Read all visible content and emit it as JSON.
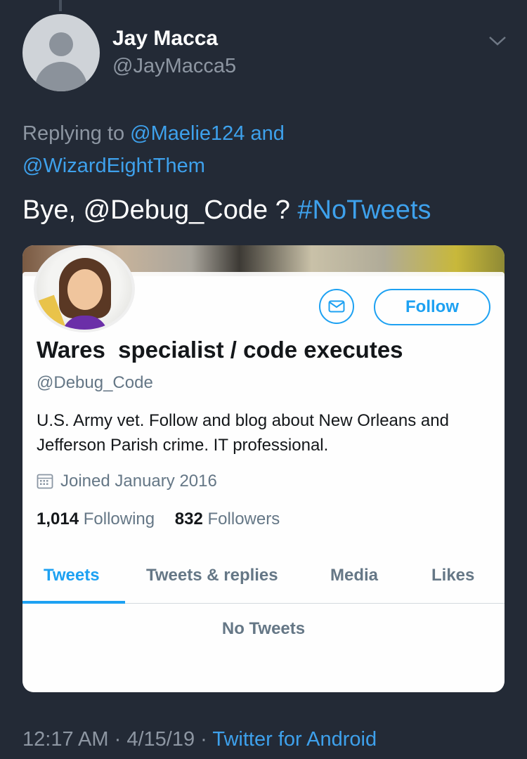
{
  "tweet": {
    "author_name": "Jay Macca",
    "author_handle": "@JayMacca5",
    "replying_prefix": "Replying to",
    "reply_to_1": "@Maelie124",
    "reply_and": "and",
    "reply_to_2": "@WizardEightThem",
    "text_prefix": "Bye,",
    "mention": "@Debug_Code",
    "text_mid": "?",
    "hashtag": "#NoTweets",
    "time": "12:17 AM",
    "sep": "·",
    "date": "4/15/19",
    "source": "Twitter for Android",
    "link_color": "#3ea1ec"
  },
  "embedded_profile": {
    "follow_label": "Follow",
    "mail_icon": "envelope-icon",
    "display_name": "Wares  specialist / code executes",
    "handle": "@Debug_Code",
    "bio": "U.S. Army vet. Follow and blog about New Orleans and Jefferson Parish crime. IT professional.",
    "joined": "Joined January 2016",
    "following_count": "1,014",
    "following_label": "Following",
    "followers_count": "832",
    "followers_label": "Followers",
    "tabs": [
      {
        "label": "Tweets",
        "active": true
      },
      {
        "label": "Tweets & replies",
        "active": false
      },
      {
        "label": "Media",
        "active": false
      },
      {
        "label": "Likes",
        "active": false
      }
    ],
    "empty_state": "No Tweets",
    "accent": "#1da1f2"
  }
}
